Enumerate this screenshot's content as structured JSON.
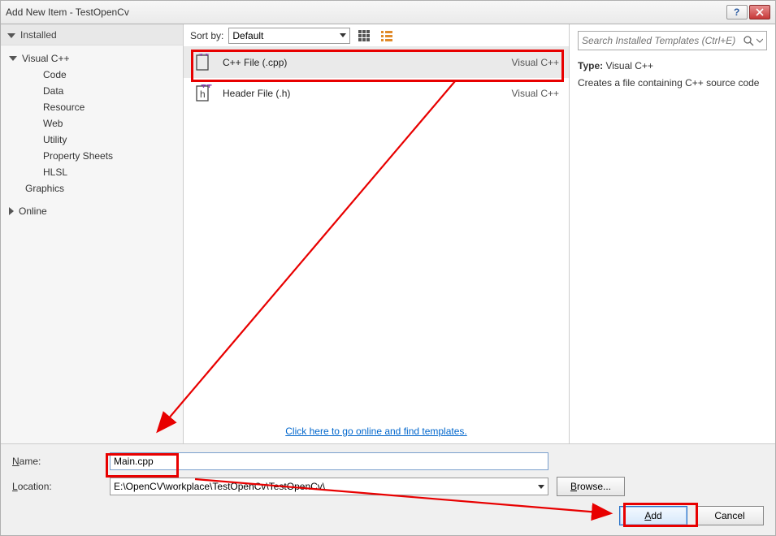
{
  "window": {
    "title": "Add New Item - TestOpenCv"
  },
  "sidebar": {
    "header": "Installed",
    "nodes": {
      "visualcpp": "Visual C++",
      "children": [
        "Code",
        "Data",
        "Resource",
        "Web",
        "Utility",
        "Property Sheets",
        "HLSL"
      ],
      "graphics": "Graphics",
      "online": "Online"
    }
  },
  "sort": {
    "label": "Sort by:",
    "value": "Default"
  },
  "templates": [
    {
      "name": "C++ File (.cpp)",
      "group": "Visual C++",
      "selected": true
    },
    {
      "name": "Header File (.h)",
      "group": "Visual C++",
      "selected": false
    }
  ],
  "onlineLink": "Click here to go online and find templates.",
  "search": {
    "placeholder": "Search Installed Templates (Ctrl+E)"
  },
  "details": {
    "typeLabel": "Type:",
    "typeValue": "Visual C++",
    "description": "Creates a file containing C++ source code"
  },
  "form": {
    "nameLabel": "Name:",
    "nameValue": "Main.cpp",
    "locationLabel": "Location:",
    "locationValue": "E:\\OpenCV\\workplace\\TestOpenCv\\TestOpenCv\\",
    "browse": "Browse...",
    "add": "Add",
    "cancel": "Cancel"
  }
}
